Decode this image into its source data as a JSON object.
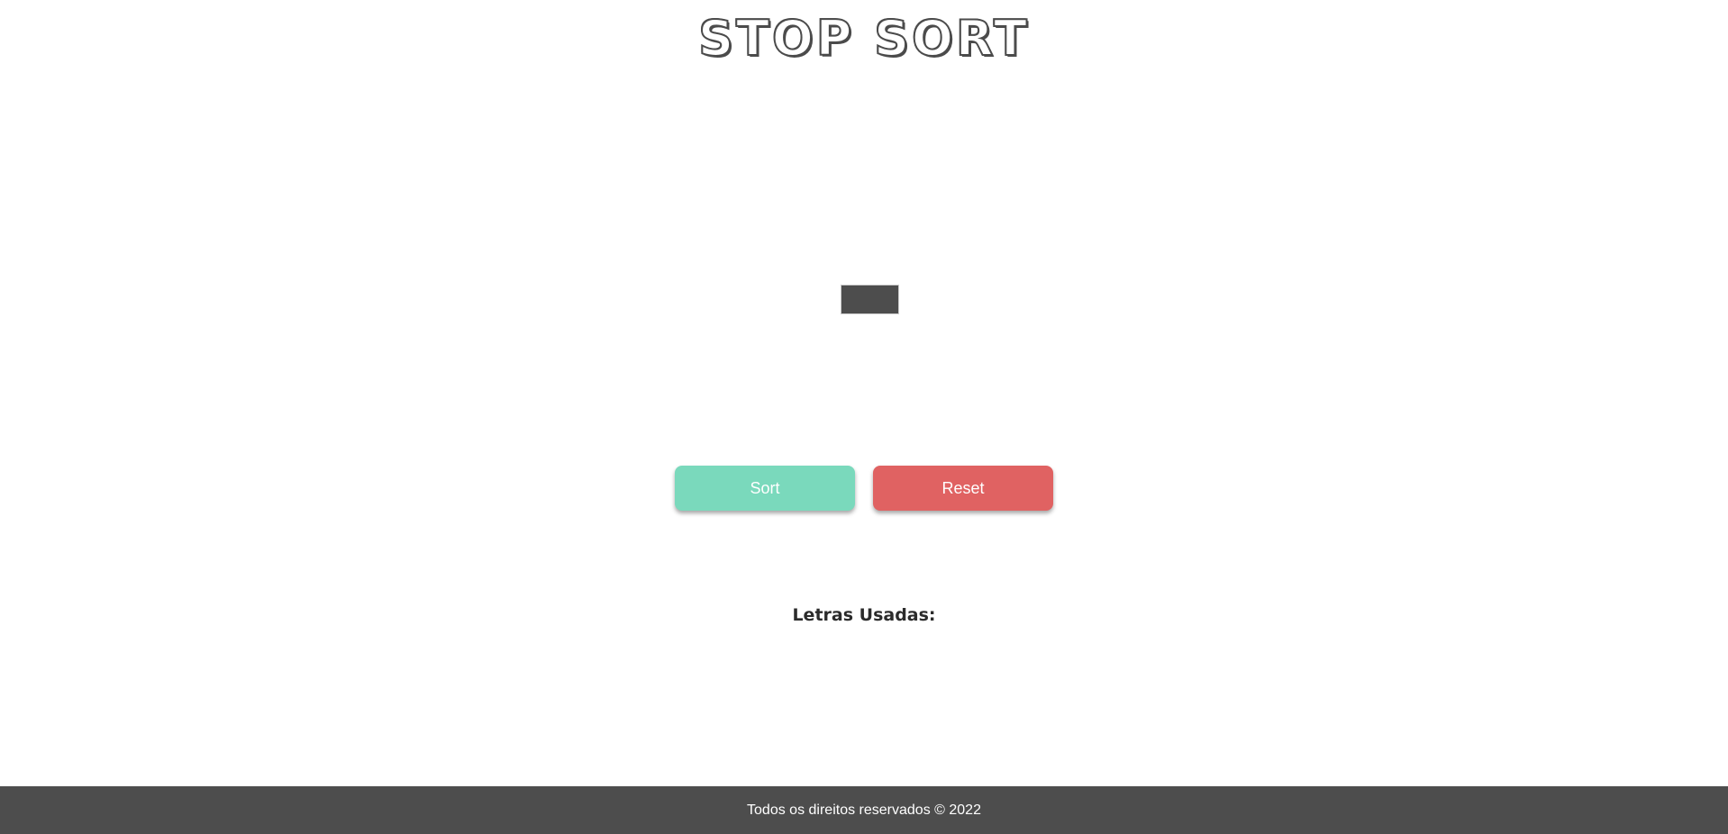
{
  "header": {
    "title": "STOP SORT"
  },
  "main": {
    "current_letter": "",
    "buttons": {
      "sort_label": "Sort",
      "reset_label": "Reset"
    },
    "used_letters": {
      "heading": "Letras Usadas:",
      "letters": ""
    }
  },
  "footer": {
    "text": "Todos os direitos reservados © 2022"
  },
  "colors": {
    "sort_button": "#7ad9bc",
    "reset_button": "#e06262",
    "footer_bg": "#4d4d4d",
    "letter_box_bg": "#4d4d4d",
    "title": "#4b4b4b"
  }
}
